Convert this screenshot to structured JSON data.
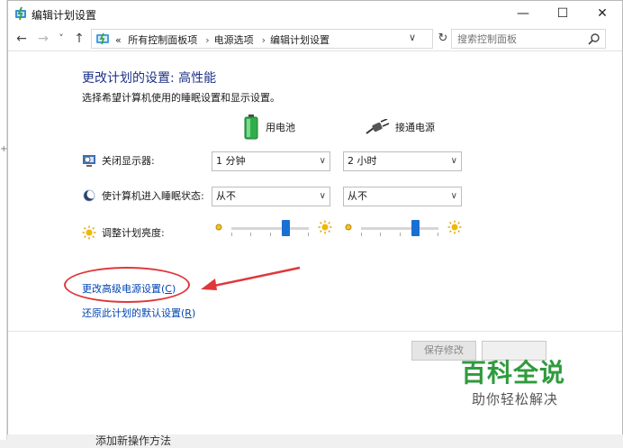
{
  "window": {
    "title": "编辑计划设置",
    "minimize": "—",
    "maximize": "☐",
    "close": "✕"
  },
  "nav": {
    "back": "←",
    "forward": "→",
    "history": "˅",
    "up": "↑"
  },
  "address": {
    "chevron": "«",
    "crumbs": [
      "所有控制面板项",
      "电源选项",
      "编辑计划设置"
    ],
    "separator": "›",
    "dropdown": "∨",
    "refresh": "↻"
  },
  "search": {
    "placeholder": "搜索控制面板"
  },
  "main": {
    "heading": "更改计划的设置: 高性能",
    "subheading": "选择希望计算机使用的睡眠设置和显示设置。",
    "col_battery": "用电池",
    "col_plugged": "接通电源",
    "rows": {
      "display_label": "关闭显示器:",
      "display_battery": "1 分钟",
      "display_plugged": "2 小时",
      "sleep_label": "使计算机进入睡眠状态:",
      "sleep_battery": "从不",
      "sleep_plugged": "从不",
      "brightness_label": "调整计划亮度:"
    },
    "brightness": {
      "battery_level": 0.7,
      "plugged_level": 0.7
    },
    "link_advanced": "更改高级电源设置(",
    "link_advanced_key": "C",
    "link_restore": "还原此计划的默认设置(",
    "link_restore_key": "R",
    "link_close": ")",
    "save_button": "保存修改",
    "cancel_button": ""
  },
  "watermark": {
    "line1": "百科全说",
    "line2": "助你轻松解决"
  },
  "background": {
    "partial_text": "添加新操作方法"
  },
  "colors": {
    "heading": "#1e3287",
    "link": "#0045b3",
    "annotation": "#e0373b",
    "slider_thumb": "#1a6fd4",
    "watermark": "#2f9b3d"
  }
}
